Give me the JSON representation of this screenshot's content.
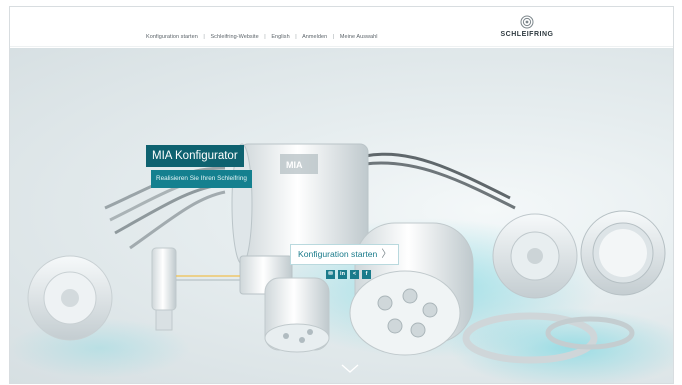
{
  "header": {
    "nav": [
      {
        "label": "Konfiguration starten"
      },
      {
        "label": "Schleifring-Website"
      },
      {
        "label": "English"
      },
      {
        "label": "Anmelden"
      },
      {
        "label": "Meine Auswahl"
      }
    ],
    "logo_text": "SCHLEIFRING"
  },
  "hero": {
    "title": "MIA Konfigurator",
    "subtitle": "Realisieren Sie Ihren Schleifring",
    "cta_label": "Konfiguration starten",
    "cta_chevron": "〉",
    "social_icons": [
      "mail-icon",
      "linkedin-icon",
      "share-icon",
      "facebook-icon"
    ],
    "social_glyphs": [
      "✉",
      "in",
      "<",
      "f"
    ],
    "product_label": "MIA"
  },
  "colors": {
    "accent_dark": "#0e6270",
    "accent": "#14808f",
    "link": "#1a7b8b"
  }
}
